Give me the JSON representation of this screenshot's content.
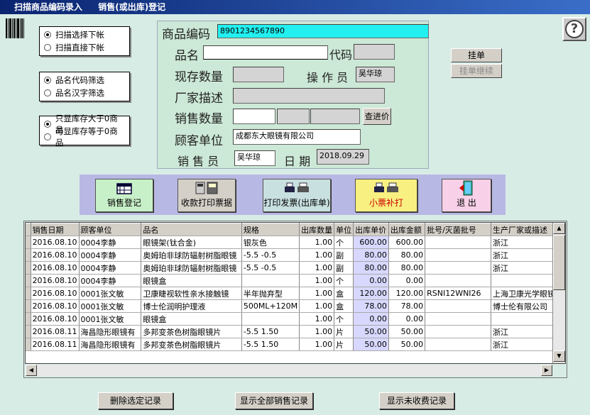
{
  "title": {
    "part1": "扫描商品编码录入",
    "part2": "销售(或出库)登记"
  },
  "radio_groups": [
    {
      "options": [
        {
          "label": "扫描选择下帐",
          "selected": true
        },
        {
          "label": "扫描直接下帐",
          "selected": false
        }
      ]
    },
    {
      "options": [
        {
          "label": "品名代码筛选",
          "selected": true
        },
        {
          "label": "品名汉字筛选",
          "selected": false
        }
      ]
    },
    {
      "options": [
        {
          "label": "只显库存大于0商品",
          "selected": true
        },
        {
          "label": "可显库存等于0商品",
          "selected": false
        }
      ]
    }
  ],
  "form": {
    "code_label": "商品编码",
    "code_value": "8901234567890",
    "name_label": "品名",
    "name_value": "",
    "daima_label": "代码",
    "daima_value": "",
    "stock_label": "现存数量",
    "stock_value": "",
    "operator_label": "操 作 员",
    "operator_value": "吴华琼",
    "maker_label": "厂家描述",
    "maker_value": "",
    "qty_label": "销售数量",
    "qty_value": "",
    "price_btn": "查进价",
    "customer_label": "顾客单位",
    "customer_value": "成都东大眼镜有限公司",
    "seller_label": "销 售 员",
    "seller_value": "吴华琼",
    "date_label": "日 期",
    "date_value": "2018.09.29"
  },
  "side_buttons": {
    "hang": "挂单",
    "resume": "挂单继续"
  },
  "toolbar": {
    "register": "销售登记",
    "print_receipt": "收款打印票据",
    "print_invoice": "打印发票(出库单)",
    "reprint": "小票补打",
    "exit": "退 出"
  },
  "grid": {
    "headers": [
      "销售日期",
      "顾客单位",
      "品名",
      "规格",
      "出库数量",
      "单位",
      "出库单价",
      "出库金额",
      "批号/灭菌批号",
      "生产厂家或描述"
    ],
    "rows": [
      [
        "2016.08.10",
        "0004李静",
        "眼镜架(钛合金)",
        "银灰色",
        "1.00",
        "个",
        "600.00",
        "600.00",
        "",
        "浙江"
      ],
      [
        "2016.08.10",
        "0004李静",
        "奥姆珀非球防辐射树脂眼镜",
        "-5.5 -0.5",
        "1.00",
        "副",
        "80.00",
        "80.00",
        "",
        "浙江"
      ],
      [
        "2016.08.10",
        "0004李静",
        "奥姆珀非球防辐射树脂眼镜",
        "-5.5 -0.5",
        "1.00",
        "副",
        "80.00",
        "80.00",
        "",
        "浙江"
      ],
      [
        "2016.08.10",
        "0004李静",
        "眼镜盒",
        "",
        "1.00",
        "个",
        "0.00",
        "0.00",
        "",
        ""
      ],
      [
        "2016.08.10",
        "0001张文敏",
        "卫康睫视软性亲水接触镜",
        "半年抛弃型",
        "1.00",
        "盒",
        "120.00",
        "120.00",
        "RSNI12WNI26",
        "上海卫康光学眼镜有"
      ],
      [
        "2016.08.10",
        "0001张文敏",
        "博士伦润明护理液",
        "500ML+120M",
        "1.00",
        "盒",
        "78.00",
        "78.00",
        "",
        "博士伦有限公司"
      ],
      [
        "2016.08.10",
        "0001张文敏",
        "眼镜盒",
        "",
        "1.00",
        "个",
        "0.00",
        "0.00",
        "",
        ""
      ],
      [
        "2016.08.11",
        "海昌隐形眼镜有",
        "多邦变茶色树脂眼镜片",
        "-5.5  1.50",
        "1.00",
        "片",
        "50.00",
        "50.00",
        "",
        "浙江"
      ],
      [
        "2016.08.11",
        "海昌隐形眼镜有",
        "多邦变茶色树脂眼镜片",
        "-5.5  1.50",
        "1.00",
        "片",
        "50.00",
        "50.00",
        "",
        "浙江"
      ]
    ]
  },
  "bottom_buttons": {
    "delete": "删除选定记录",
    "show_all": "显示全部销售记录",
    "show_unpaid": "显示未收费记录"
  }
}
